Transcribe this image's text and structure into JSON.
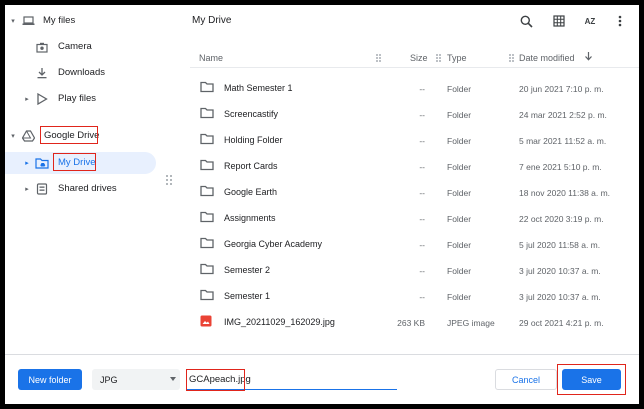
{
  "sidebar": {
    "my_files": "My files",
    "camera": "Camera",
    "downloads": "Downloads",
    "play_files": "Play files",
    "google_drive": "Google Drive",
    "my_drive": "My Drive",
    "shared_drives": "Shared drives"
  },
  "header": {
    "title": "My Drive",
    "sort_icon_text": "AZ"
  },
  "columns": {
    "name": "Name",
    "size": "Size",
    "type": "Type",
    "date": "Date modified"
  },
  "rows": [
    {
      "name": "Math Semester 1",
      "size": "--",
      "type": "Folder",
      "date": "20 jun 2021 7:10 p. m.",
      "icon": "folder-icon"
    },
    {
      "name": "Screencastify",
      "size": "--",
      "type": "Folder",
      "date": "24 mar 2021 2:52 p. m.",
      "icon": "folder-icon"
    },
    {
      "name": "Holding Folder",
      "size": "--",
      "type": "Folder",
      "date": "5 mar 2021 11:52 a. m.",
      "icon": "folder-icon"
    },
    {
      "name": "Report Cards",
      "size": "--",
      "type": "Folder",
      "date": "7 ene 2021 5:10 p. m.",
      "icon": "folder-icon"
    },
    {
      "name": "Google Earth",
      "size": "--",
      "type": "Folder",
      "date": "18 nov 2020 11:38 a. m.",
      "icon": "folder-icon"
    },
    {
      "name": "Assignments",
      "size": "--",
      "type": "Folder",
      "date": "22 oct 2020 3:19 p. m.",
      "icon": "folder-icon"
    },
    {
      "name": "Georgia Cyber Academy",
      "size": "--",
      "type": "Folder",
      "date": "5 jul 2020 11:58 a. m.",
      "icon": "folder-icon"
    },
    {
      "name": "Semester 2",
      "size": "--",
      "type": "Folder",
      "date": "3 jul 2020 10:37 a. m.",
      "icon": "folder-icon"
    },
    {
      "name": "Semester 1",
      "size": "--",
      "type": "Folder",
      "date": "3 jul 2020 10:37 a. m.",
      "icon": "folder-icon"
    },
    {
      "name": "IMG_20211029_162029.jpg",
      "size": "263 KB",
      "type": "JPEG image",
      "date": "29 oct 2021 4:21 p. m.",
      "icon": "image-file-icon"
    }
  ],
  "footer": {
    "new_folder": "New folder",
    "file_type": "JPG",
    "filename": "GCApeach.jpg",
    "cancel": "Cancel",
    "save": "Save"
  },
  "colors": {
    "accent": "#1a73e8",
    "highlight_box": "#e0251b",
    "selected_bg": "#e8f0fe",
    "image_file": "#ea4335"
  }
}
